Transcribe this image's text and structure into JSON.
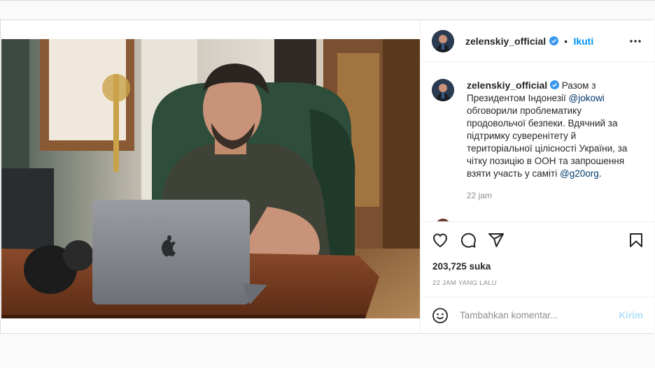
{
  "post": {
    "username": "zelenskiy_official",
    "follow_label": "Ikuti",
    "more_icon": "more-horizontal-icon",
    "caption_text": "Разом з Президентом Індонезії",
    "caption_mention": "@jokowi",
    "caption_rest": "обговорили проблематику продовольчої безпеки. Вдячний за підтримку суверенітету й територіальної цілісності України, за чітку позицію в ООН та запрошення взяти участь у саміті",
    "caption_tag": "@g20org",
    "caption_end": ".",
    "comment_time": "22 jam",
    "likes": "203,725 suka",
    "posted_ago": "22 JAM YANG LALU",
    "comment_placeholder": "Tambahkan komentar...",
    "send_label": "Kirim"
  },
  "icons": {
    "like": "heart-icon",
    "comment": "comment-icon",
    "share": "share-icon",
    "save": "bookmark-icon",
    "emoji": "emoji-icon",
    "verified": "verified-badge-icon"
  },
  "colors": {
    "link": "#00376b",
    "verified": "#3897f0",
    "send_disabled": "#b2dffc",
    "follow": "#0095f6"
  }
}
